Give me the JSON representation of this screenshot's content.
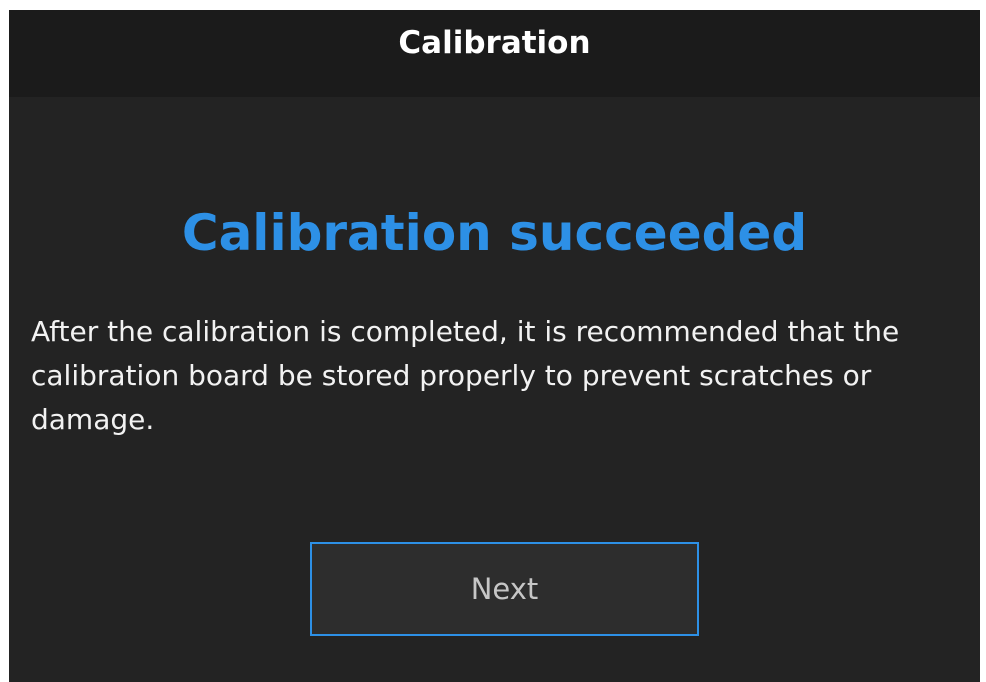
{
  "window": {
    "title": "Calibration"
  },
  "result": {
    "heading": "Calibration succeeded",
    "message": "After the calibration is completed, it is recommended that the calibration board be stored properly to prevent scratches or damage."
  },
  "actions": {
    "next_label": "Next"
  },
  "colors": {
    "accent": "#2d90e6",
    "background": "#232323",
    "titlebar": "#1b1b1b"
  }
}
